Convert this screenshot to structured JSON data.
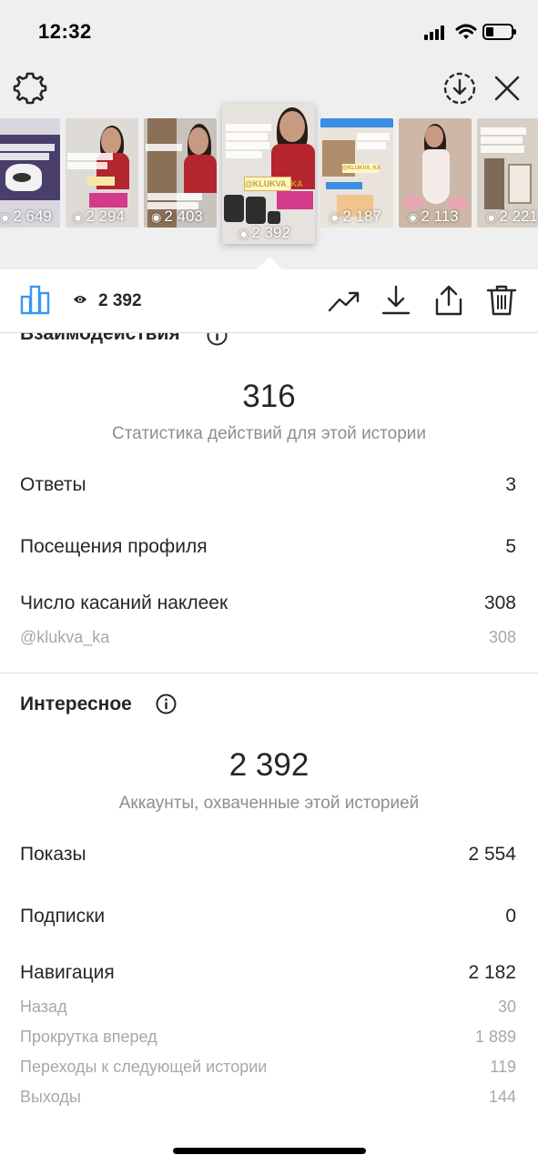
{
  "status_bar": {
    "time": "12:32"
  },
  "thumbnails": [
    {
      "views": "2 649"
    },
    {
      "views": "2 294"
    },
    {
      "views": "2 403"
    },
    {
      "views": "2 392",
      "selected": true,
      "tag": "@KLUKVA_KA"
    },
    {
      "views": "2 187",
      "tag": "@KLUKVA_KA"
    },
    {
      "views": "2 113"
    },
    {
      "views": "2 221"
    }
  ],
  "toolbar": {
    "views": "2 392"
  },
  "interactions": {
    "title": "Взаимодействия",
    "total": "316",
    "caption": "Статистика действий для этой истории",
    "rows": [
      {
        "label": "Ответы",
        "value": "3"
      },
      {
        "label": "Посещения профиля",
        "value": "5"
      },
      {
        "label": "Число касаний наклеек",
        "value": "308"
      }
    ],
    "sticker_sub": {
      "label": "@klukva_ka",
      "value": "308"
    }
  },
  "discovery": {
    "title": "Интересное",
    "total": "2 392",
    "caption": "Аккаунты, охваченные этой историей",
    "rows": [
      {
        "label": "Показы",
        "value": "2 554"
      },
      {
        "label": "Подписки",
        "value": "0"
      },
      {
        "label": "Навигация",
        "value": "2 182"
      }
    ],
    "navigation_sub": [
      {
        "label": "Назад",
        "value": "30"
      },
      {
        "label": "Прокрутка вперед",
        "value": "1 889"
      },
      {
        "label": "Переходы к следующей истории",
        "value": "119"
      },
      {
        "label": "Выходы",
        "value": "144"
      }
    ]
  },
  "colors": {
    "accent": "#3897f0",
    "text": "#262626",
    "muted": "#8e8e8e",
    "background_top": "#efefef"
  },
  "icons": [
    "gear-icon",
    "download-circle-icon",
    "close-icon",
    "bar-chart-icon",
    "eye-icon",
    "trend-icon",
    "download-icon",
    "share-icon",
    "trash-icon",
    "info-icon"
  ]
}
